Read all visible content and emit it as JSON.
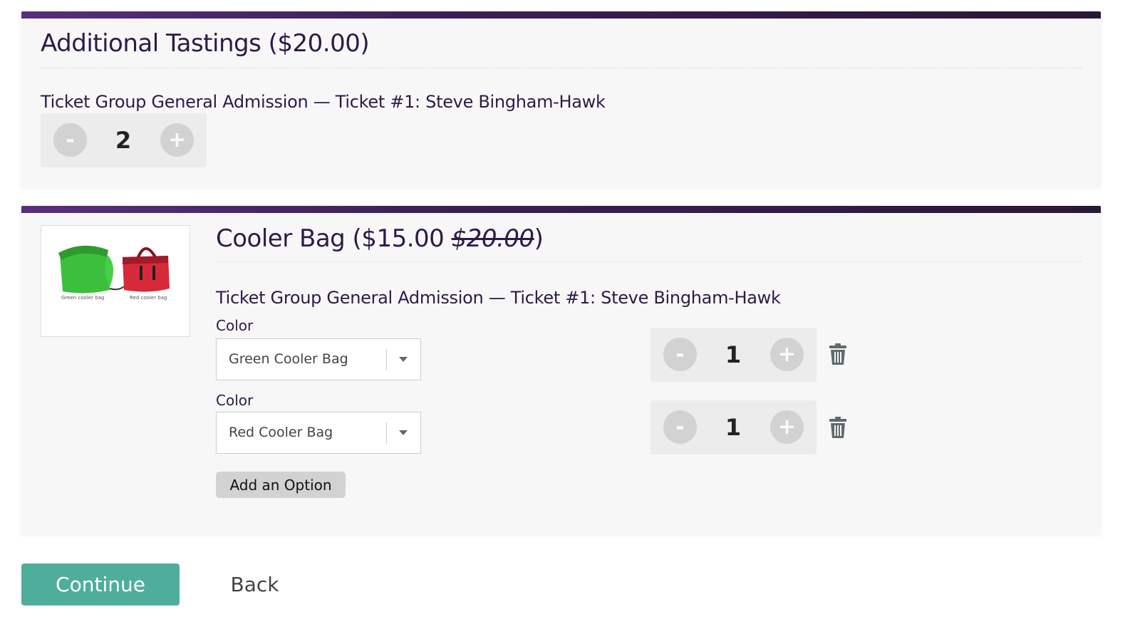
{
  "tastings": {
    "title": "Additional Tastings ($20.00)",
    "ticket_label": "Ticket Group General Admission — Ticket #1: Steve Bingham-Hawk",
    "quantity": "2",
    "minus_label": "-",
    "plus_label": "+"
  },
  "cooler": {
    "title_prefix": "Cooler Bag ($15.00 ",
    "original_price": "$20.00",
    "title_suffix": ")",
    "ticket_label": "Ticket Group General Admission — Ticket #1: Steve Bingham-Hawk",
    "image_captions": [
      "Green cooler bag",
      "Red cooler bag"
    ],
    "options": [
      {
        "label": "Color",
        "selected": "Green Cooler Bag",
        "quantity": "1"
      },
      {
        "label": "Color",
        "selected": "Red Cooler Bag",
        "quantity": "1"
      }
    ],
    "minus_label": "-",
    "plus_label": "+",
    "add_option_label": "Add an Option"
  },
  "actions": {
    "continue_label": "Continue",
    "back_label": "Back"
  },
  "colors": {
    "accent_bar": "#3a1f57",
    "title_text": "#2e1a47",
    "continue_bg": "#4fae9b"
  },
  "icons": [
    "trash-icon",
    "chevron-down-icon"
  ]
}
